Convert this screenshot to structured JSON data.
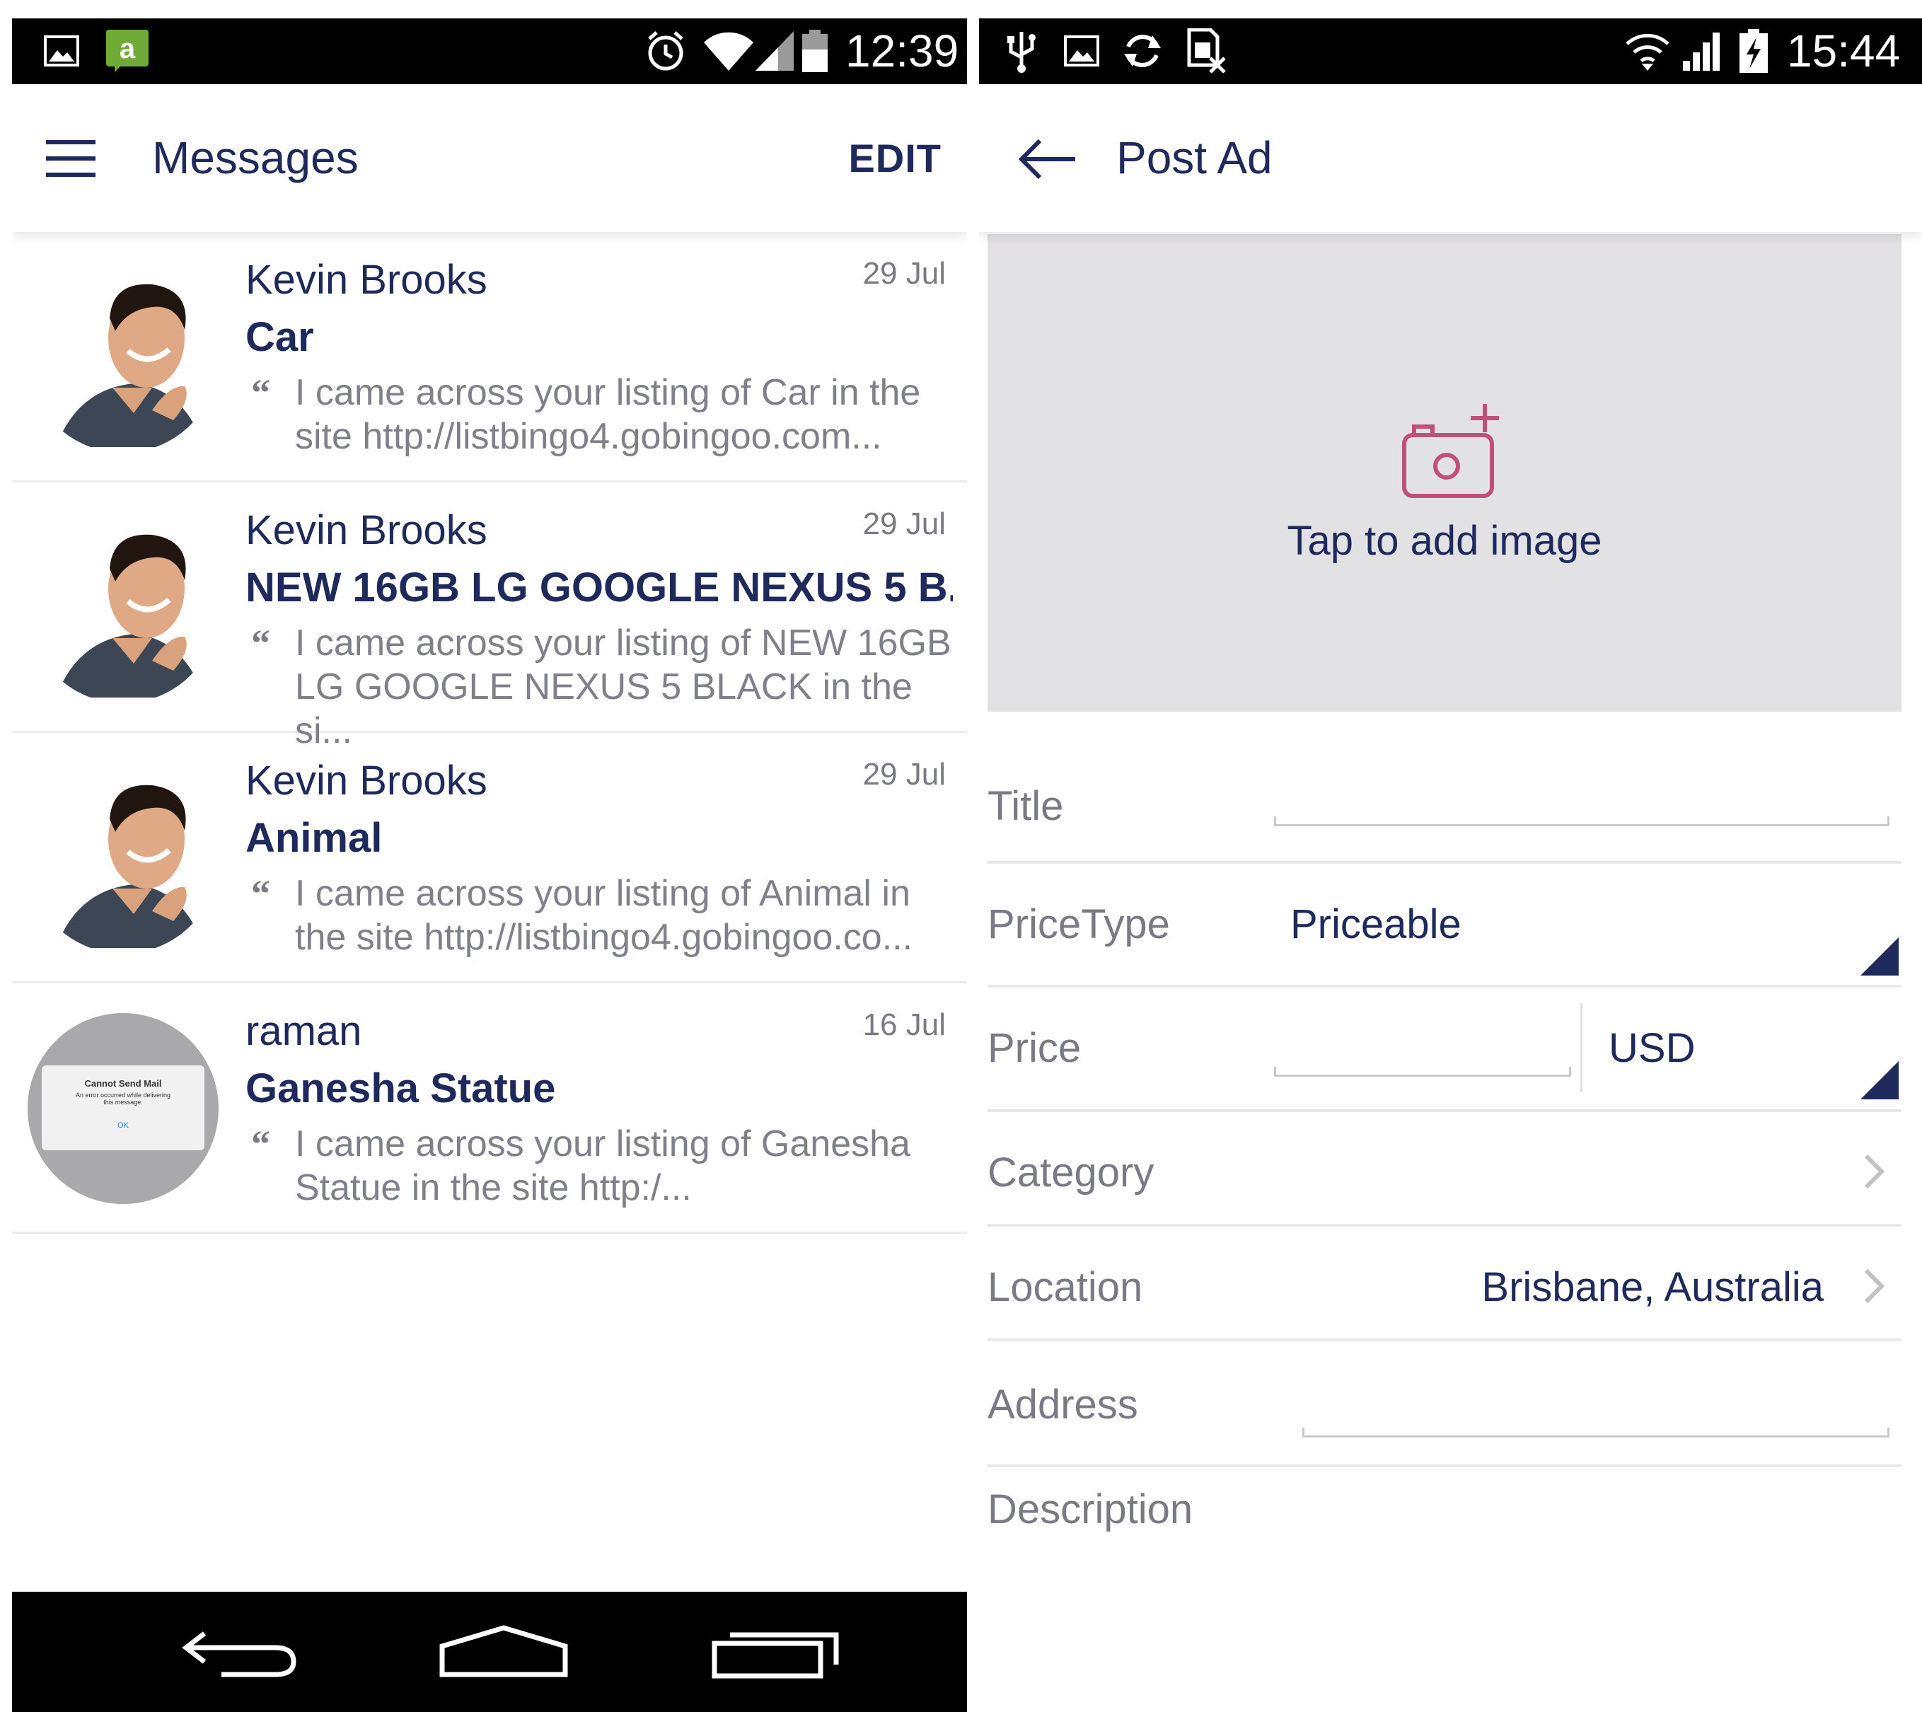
{
  "left_screen": {
    "status_bar": {
      "icons": [
        "gallery-icon",
        "amazon-app-icon",
        "alarm-icon",
        "wifi-icon",
        "signal-icon",
        "battery-icon"
      ],
      "time": "12:39"
    },
    "app_bar": {
      "menu_icon": "hamburger-menu-icon",
      "title": "Messages",
      "action_label": "EDIT"
    },
    "messages": [
      {
        "sender": "Kevin Brooks",
        "date": "29 Jul",
        "subject": "Car",
        "quote_mark": "“",
        "preview_line1": "I came across your listing of Car in the",
        "preview_line2": "site http://listbingo4.gobingoo.com...",
        "avatar": "person-avatar"
      },
      {
        "sender": "Kevin Brooks",
        "date": "29 Jul",
        "subject": "NEW 16GB LG GOOGLE NEXUS 5 B...",
        "quote_mark": "“",
        "preview_line1": "I came across your listing of NEW 16GB",
        "preview_line2": "LG GOOGLE NEXUS 5 BLACK  in the si...",
        "avatar": "person-avatar"
      },
      {
        "sender": "Kevin Brooks",
        "date": "29 Jul",
        "subject": "Animal",
        "quote_mark": "“",
        "preview_line1": "I came across your listing of Animal in",
        "preview_line2": "the site http://listbingo4.gobingoo.co...",
        "avatar": "person-avatar"
      },
      {
        "sender": "raman",
        "date": "16 Jul",
        "subject": "Ganesha Statue",
        "quote_mark": "“",
        "preview_line1": "I came across your listing of Ganesha",
        "preview_line2": "Statue in the site http:/...",
        "avatar": "screenshot-avatar",
        "avatar_dialog": {
          "title": "Cannot Send Mail",
          "line1": "An error occurred while delivering",
          "line2": "this message.",
          "button": "OK"
        }
      }
    ],
    "nav_bar": [
      "back-nav-icon",
      "home-nav-icon",
      "recents-nav-icon"
    ]
  },
  "right_screen": {
    "status_bar": {
      "icons": [
        "usb-icon",
        "gallery-icon",
        "sync-icon",
        "sim-blocked-icon",
        "wifi-icon",
        "signal-icon",
        "battery-charging-icon"
      ],
      "time": "15:44"
    },
    "app_bar": {
      "back_icon": "arrow-back-icon",
      "title": "Post Ad"
    },
    "image_picker": {
      "icon": "add-camera-icon",
      "label": "Tap to add image"
    },
    "form": {
      "title_label": "Title",
      "title_value": "",
      "price_type_label": "PriceType",
      "price_type_value": "Priceable",
      "price_label": "Price",
      "price_value": "",
      "currency_value": "USD",
      "category_label": "Category",
      "category_value": "",
      "location_label": "Location",
      "location_value": "Brisbane, Australia",
      "address_label": "Address",
      "address_value": "",
      "description_label": "Description"
    }
  },
  "colors": {
    "primary_text": "#1f2a5c",
    "secondary_text": "#7a7a84",
    "camera_accent": "#c0507a",
    "picker_background": "#e2e1e4",
    "status_bar": "#000000"
  }
}
